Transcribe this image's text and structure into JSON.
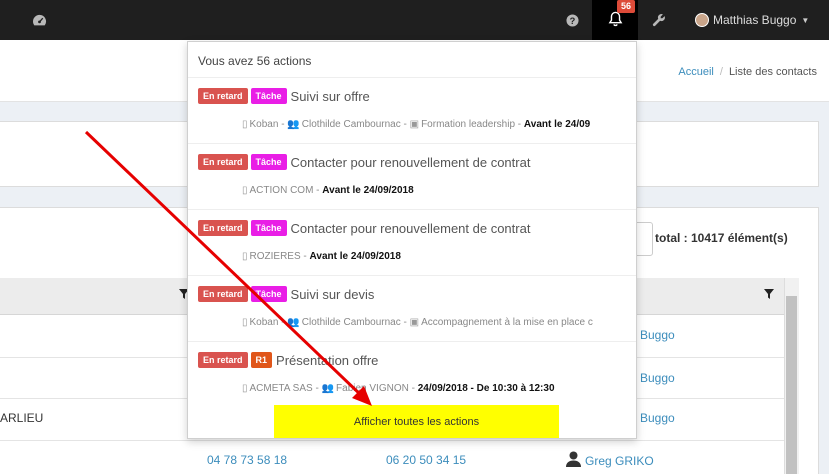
{
  "topbar": {
    "notification_count": "56",
    "user_name": "Matthias Buggo",
    "icons": [
      "dashboard-icon",
      "help-icon",
      "bell-icon",
      "wrench-icon"
    ]
  },
  "breadcrumb": {
    "home": "Accueil",
    "current": "Liste des contacts"
  },
  "table": {
    "total": "total : 10417 élément(s)",
    "rows": [
      {
        "col1": "",
        "col2": "",
        "col3": "",
        "col4": "Buggo"
      },
      {
        "col1": "",
        "col2": "",
        "col3": "",
        "col4": "Buggo"
      },
      {
        "col1": "ARLIEU",
        "col2": "",
        "col3": "",
        "col4": "Buggo"
      },
      {
        "col1": "",
        "col2": "04 78 73 58 18",
        "col3": "06 20 50 34 15",
        "col4": "Greg GRIKO"
      }
    ]
  },
  "notifications": {
    "header": "Vous avez 56 actions",
    "footer": "Afficher toutes les actions",
    "colors": {
      "late": "#d9534f",
      "task": "#e91ee6",
      "r1": "#e0561a",
      "highlight": "#ffff00"
    },
    "items": [
      {
        "status": "En retard",
        "type": "Tâche",
        "title": "Suivi sur offre",
        "company": "Koban",
        "contact": "Clothilde Cambournac",
        "project": "Formation leadership",
        "due": "Avant le 24/09"
      },
      {
        "status": "En retard",
        "type": "Tâche",
        "title": "Contacter pour renouvellement de contrat",
        "company": "ACTION COM",
        "contact": "",
        "project": "",
        "due": "Avant le 24/09/2018"
      },
      {
        "status": "En retard",
        "type": "Tâche",
        "title": "Contacter pour renouvellement de contrat",
        "company": "ROZIERES",
        "contact": "",
        "project": "",
        "due": "Avant le 24/09/2018"
      },
      {
        "status": "En retard",
        "type": "Tâche",
        "title": "Suivi sur devis",
        "company": "Koban",
        "contact": "Clothilde Cambournac",
        "project": "Accompagnement à la mise en place c",
        "due": ""
      },
      {
        "status": "En retard",
        "type": "R1",
        "title": "Présentation offre",
        "company": "ACMETA SAS",
        "contact": "Fabien VIGNON",
        "project": "",
        "due": "24/09/2018 - De 10:30 à 12:30"
      }
    ]
  }
}
